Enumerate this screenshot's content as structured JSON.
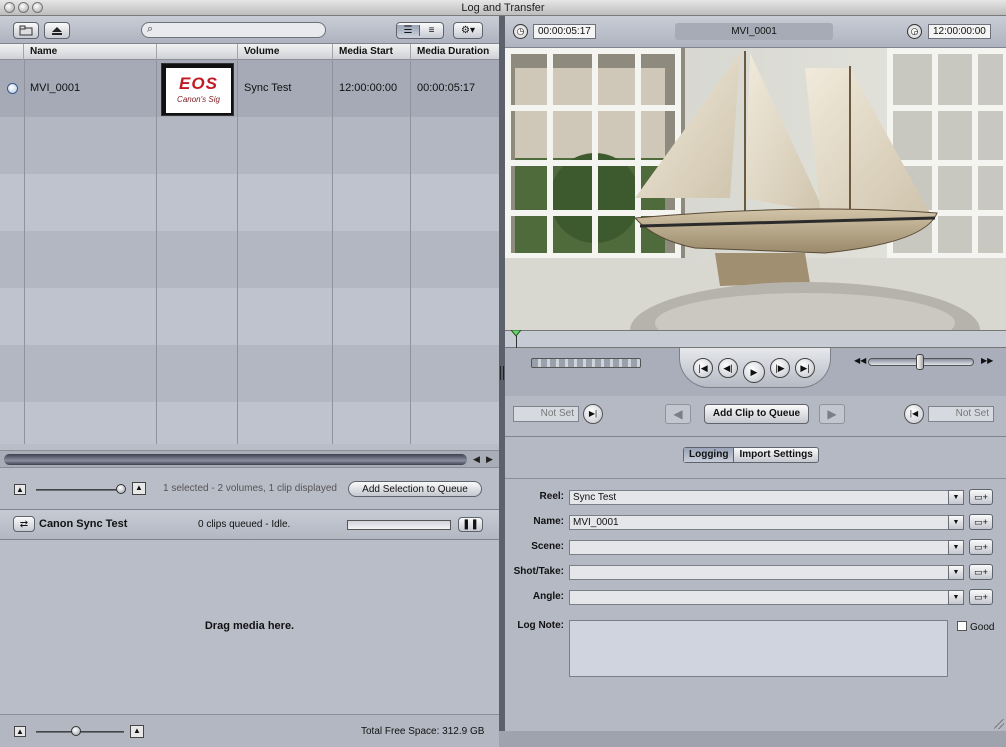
{
  "window": {
    "title": "Log and Transfer"
  },
  "browser": {
    "columns": [
      "Name",
      "",
      "Volume",
      "Media Start",
      "Media Duration"
    ],
    "clips": [
      {
        "name": "MVI_0001",
        "volume": "Sync Test",
        "media_start": "12:00:00:00",
        "media_duration": "00:00:05:17",
        "thumb_logo": "EOS",
        "thumb_sig": "Canon's Sig"
      }
    ],
    "status": "1 selected - 2 volumes, 1 clip displayed",
    "add_selection_label": "Add Selection to Queue"
  },
  "queue": {
    "project": "Canon Sync Test",
    "status": "0 clips queued - Idle.",
    "drop_hint": "Drag media here.",
    "free_space": "Total Free Space: 312.9 GB"
  },
  "viewer": {
    "timecode_duration": "00:00:05:17",
    "clip_name": "MVI_0001",
    "timecode_current": "12:00:00:00",
    "mark_in": "Not Set",
    "mark_out": "Not Set",
    "add_clip_label": "Add Clip to Queue"
  },
  "logging": {
    "tabs": [
      "Logging",
      "Import Settings"
    ],
    "active_tab": "Logging",
    "fields": [
      {
        "label": "Reel:",
        "value": "Sync Test"
      },
      {
        "label": "Name:",
        "value": "MVI_0001"
      },
      {
        "label": "Scene:",
        "value": ""
      },
      {
        "label": "Shot/Take:",
        "value": ""
      },
      {
        "label": "Angle:",
        "value": ""
      }
    ],
    "log_note_label": "Log Note:",
    "log_note": "",
    "good_label": "Good"
  },
  "icons": {
    "window_close": "circle",
    "search": "magnifier-icon",
    "transport": [
      "go-to-start",
      "step-back",
      "play",
      "step-forward",
      "go-to-end"
    ]
  }
}
